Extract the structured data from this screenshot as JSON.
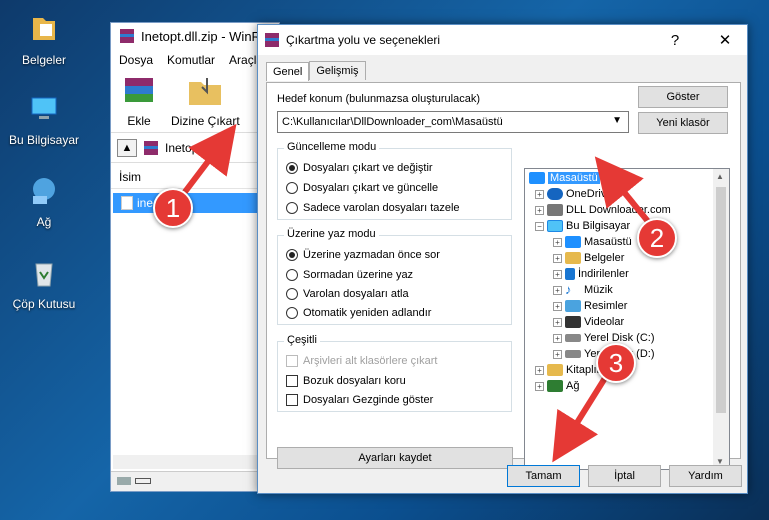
{
  "desktop": {
    "icons": [
      {
        "label": "Belgeler",
        "icon": "folder-documents-icon"
      },
      {
        "label": "Bu Bilgisayar",
        "icon": "computer-icon"
      },
      {
        "label": "Ağ",
        "icon": "network-icon"
      },
      {
        "label": "Çöp Kutusu",
        "icon": "recycle-bin-icon"
      }
    ]
  },
  "winrar": {
    "title": "Inetopt.dll.zip - WinR",
    "menu": [
      "Dosya",
      "Komutlar",
      "Araçla"
    ],
    "toolbar": {
      "add_label": "Ekle",
      "extract_label": "Dizine Çıkart"
    },
    "path": "Inetopt.dll.zi",
    "list_header": "İsim",
    "selected_file": "ine"
  },
  "dialog": {
    "title": "Çıkartma yolu ve seçenekleri",
    "help_glyph": "?",
    "close_glyph": "✕",
    "tabs": [
      "Genel",
      "Gelişmiş"
    ],
    "dest_label": "Hedef konum (bulunmazsa oluşturulacak)",
    "dest_value": "C:\\Kullanıcılar\\DllDownloader_com\\Masaüstü",
    "show_button": "Göster",
    "new_folder_button": "Yeni klasör",
    "update_mode": {
      "title": "Güncelleme modu",
      "options": [
        "Dosyaları çıkart ve değiştir",
        "Dosyaları çıkart ve güncelle",
        "Sadece varolan dosyaları tazele"
      ],
      "selected": 0
    },
    "overwrite_mode": {
      "title": "Üzerine yaz modu",
      "options": [
        "Üzerine yazmadan önce sor",
        "Sormadan üzerine yaz",
        "Varolan dosyaları atla",
        "Otomatik yeniden adlandır"
      ],
      "selected": 0
    },
    "misc": {
      "title": "Çeşitli",
      "options": [
        "Arşivleri alt klasörlere çıkart",
        "Bozuk dosyaları koru",
        "Dosyaları Gezginde göster"
      ]
    },
    "save_settings_button": "Ayarları kaydet",
    "tree": [
      {
        "label": "Masaüstü",
        "selected": true,
        "icon": "desktop-icon",
        "color": "#1e90ff"
      },
      {
        "label": "OneDrive",
        "icon": "onedrive-icon",
        "color": "#1565c0"
      },
      {
        "label": "DLL Downloader.com",
        "icon": "user-folder-icon",
        "color": "#555555"
      },
      {
        "label": "Bu Bilgisayar",
        "icon": "computer-icon",
        "color": "#1e88e5"
      },
      {
        "label": "Masaüstü",
        "icon": "desktop-icon",
        "color": "#1e90ff"
      },
      {
        "label": "Belgeler",
        "icon": "documents-icon",
        "color": "#e6b94d"
      },
      {
        "label": "İndirilenler",
        "icon": "downloads-icon",
        "color": "#1976d2"
      },
      {
        "label": "Müzik",
        "icon": "music-icon",
        "color": "#1976d2"
      },
      {
        "label": "Resimler",
        "icon": "pictures-icon",
        "color": "#4aa3df"
      },
      {
        "label": "Videolar",
        "icon": "videos-icon",
        "color": "#333333"
      },
      {
        "label": "Yerel Disk (C:)",
        "icon": "drive-icon",
        "color": "#888888"
      },
      {
        "label": "Yerel Disk (D:)",
        "icon": "drive-icon",
        "color": "#888888"
      },
      {
        "label": "Kitaplıklar",
        "icon": "libraries-icon",
        "color": "#e6b94d"
      },
      {
        "label": "Ağ",
        "icon": "network-icon",
        "color": "#2e7d32"
      }
    ],
    "ok_button": "Tamam",
    "cancel_button": "İptal",
    "help_button": "Yardım"
  },
  "annotations": [
    "1",
    "2",
    "3"
  ],
  "colors": {
    "accent": "#3399ff",
    "annotation": "#e53935"
  }
}
